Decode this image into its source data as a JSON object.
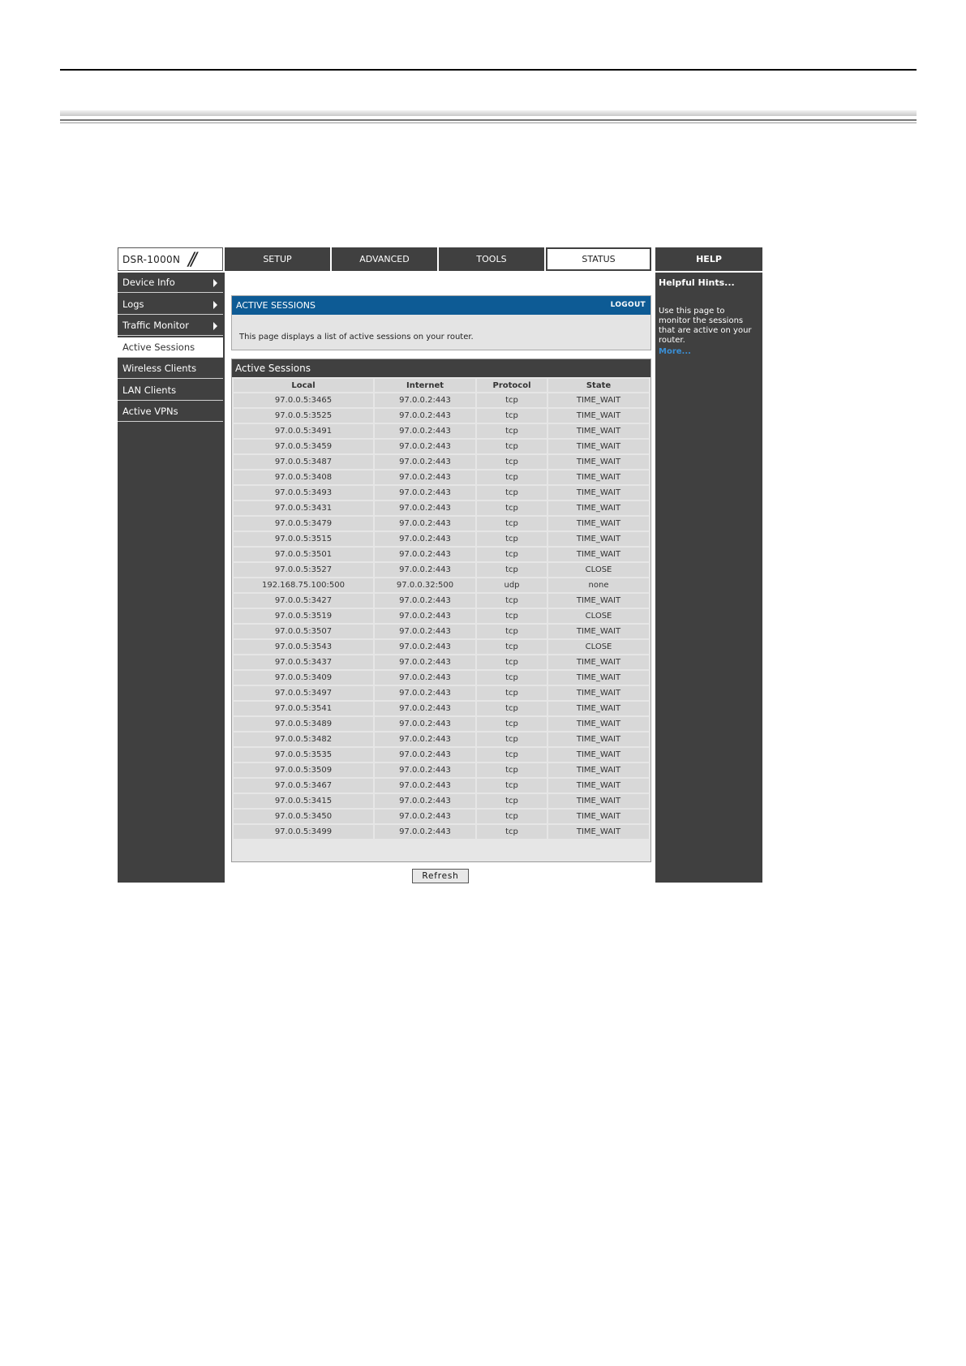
{
  "device": {
    "model": "DSR-1000N",
    "slashes": "//"
  },
  "tabs": [
    {
      "label": "SETUP",
      "active": false
    },
    {
      "label": "ADVANCED",
      "active": false
    },
    {
      "label": "TOOLS",
      "active": false
    },
    {
      "label": "STATUS",
      "active": true
    }
  ],
  "help_tab": "HELP",
  "sidebar": {
    "items": [
      {
        "label": "Device Info",
        "has_arrow": true
      },
      {
        "label": "Logs",
        "has_arrow": true
      },
      {
        "label": "Traffic Monitor",
        "has_arrow": true
      },
      {
        "label": "Active Sessions",
        "active": true
      },
      {
        "label": "Wireless Clients"
      },
      {
        "label": "LAN Clients"
      },
      {
        "label": "Active VPNs"
      }
    ]
  },
  "intro": {
    "title": "ACTIVE SESSIONS",
    "logout": "LOGOUT",
    "text": "This page displays a list of active sessions on your router."
  },
  "sessions": {
    "title": "Active Sessions",
    "columns": [
      "Local",
      "Internet",
      "Protocol",
      "State"
    ],
    "rows": [
      [
        "97.0.0.5:3465",
        "97.0.0.2:443",
        "tcp",
        "TIME_WAIT"
      ],
      [
        "97.0.0.5:3525",
        "97.0.0.2:443",
        "tcp",
        "TIME_WAIT"
      ],
      [
        "97.0.0.5:3491",
        "97.0.0.2:443",
        "tcp",
        "TIME_WAIT"
      ],
      [
        "97.0.0.5:3459",
        "97.0.0.2:443",
        "tcp",
        "TIME_WAIT"
      ],
      [
        "97.0.0.5:3487",
        "97.0.0.2:443",
        "tcp",
        "TIME_WAIT"
      ],
      [
        "97.0.0.5:3408",
        "97.0.0.2:443",
        "tcp",
        "TIME_WAIT"
      ],
      [
        "97.0.0.5:3493",
        "97.0.0.2:443",
        "tcp",
        "TIME_WAIT"
      ],
      [
        "97.0.0.5:3431",
        "97.0.0.2:443",
        "tcp",
        "TIME_WAIT"
      ],
      [
        "97.0.0.5:3479",
        "97.0.0.2:443",
        "tcp",
        "TIME_WAIT"
      ],
      [
        "97.0.0.5:3515",
        "97.0.0.2:443",
        "tcp",
        "TIME_WAIT"
      ],
      [
        "97.0.0.5:3501",
        "97.0.0.2:443",
        "tcp",
        "TIME_WAIT"
      ],
      [
        "97.0.0.5:3527",
        "97.0.0.2:443",
        "tcp",
        "CLOSE"
      ],
      [
        "192.168.75.100:500",
        "97.0.0.32:500",
        "udp",
        "none"
      ],
      [
        "97.0.0.5:3427",
        "97.0.0.2:443",
        "tcp",
        "TIME_WAIT"
      ],
      [
        "97.0.0.5:3519",
        "97.0.0.2:443",
        "tcp",
        "CLOSE"
      ],
      [
        "97.0.0.5:3507",
        "97.0.0.2:443",
        "tcp",
        "TIME_WAIT"
      ],
      [
        "97.0.0.5:3543",
        "97.0.0.2:443",
        "tcp",
        "CLOSE"
      ],
      [
        "97.0.0.5:3437",
        "97.0.0.2:443",
        "tcp",
        "TIME_WAIT"
      ],
      [
        "97.0.0.5:3409",
        "97.0.0.2:443",
        "tcp",
        "TIME_WAIT"
      ],
      [
        "97.0.0.5:3497",
        "97.0.0.2:443",
        "tcp",
        "TIME_WAIT"
      ],
      [
        "97.0.0.5:3541",
        "97.0.0.2:443",
        "tcp",
        "TIME_WAIT"
      ],
      [
        "97.0.0.5:3489",
        "97.0.0.2:443",
        "tcp",
        "TIME_WAIT"
      ],
      [
        "97.0.0.5:3482",
        "97.0.0.2:443",
        "tcp",
        "TIME_WAIT"
      ],
      [
        "97.0.0.5:3535",
        "97.0.0.2:443",
        "tcp",
        "TIME_WAIT"
      ],
      [
        "97.0.0.5:3509",
        "97.0.0.2:443",
        "tcp",
        "TIME_WAIT"
      ],
      [
        "97.0.0.5:3467",
        "97.0.0.2:443",
        "tcp",
        "TIME_WAIT"
      ],
      [
        "97.0.0.5:3415",
        "97.0.0.2:443",
        "tcp",
        "TIME_WAIT"
      ],
      [
        "97.0.0.5:3450",
        "97.0.0.2:443",
        "tcp",
        "TIME_WAIT"
      ],
      [
        "97.0.0.5:3499",
        "97.0.0.2:443",
        "tcp",
        "TIME_WAIT"
      ]
    ],
    "refresh_label": "Refresh"
  },
  "help": {
    "title": "Helpful Hints...",
    "text": "Use this page to monitor the sessions that are active on your router.",
    "more": "More..."
  },
  "colors": {
    "nav_dark": "#404040",
    "header_blue": "#0d5b95",
    "link_blue": "#3a8fd6"
  }
}
